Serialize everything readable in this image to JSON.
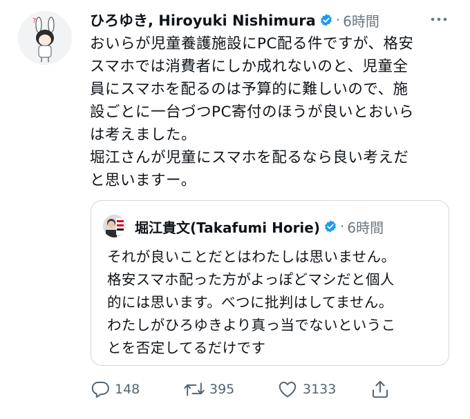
{
  "tweet": {
    "author_name": "ひろゆき, Hiroyuki Nishimura",
    "separator": "·",
    "time": "6時間",
    "text": "おいらが児童養護施設にPC配る件ですが、格安\nスマホでは消費者にしか成れないのと、児童全\n員にスマホを配るのは予算的に難しいので、施\n設ごとに一台づつPC寄付のほうが良いとおいら\nは考えました。\n堀江さんが児童にスマホを配るなら良い考えだ\nと思いますー。"
  },
  "quoted_tweet": {
    "author_name": "堀江貴文(Takafumi Horie)",
    "separator": "·",
    "time": "6時間",
    "text": "それが良いことだとはわたしは思いません。\n格安スマホ配った方がよっぽどマシだと個人\n的には思います。べつに批判はしてません。\nわたしがひろゆきより真っ当でないというこ\nとを否定してるだけです"
  },
  "actions": {
    "reply_count": "148",
    "retweet_count": "395",
    "like_count": "3133"
  },
  "icons": {
    "verified": "verified-badge-icon",
    "more": "more-options-icon",
    "reply": "reply-icon",
    "retweet": "retweet-icon",
    "like": "heart-icon",
    "share": "share-icon"
  },
  "colors": {
    "verified_blue": "#1d9bf0",
    "secondary_text": "#536471",
    "border": "#cfd9de"
  }
}
